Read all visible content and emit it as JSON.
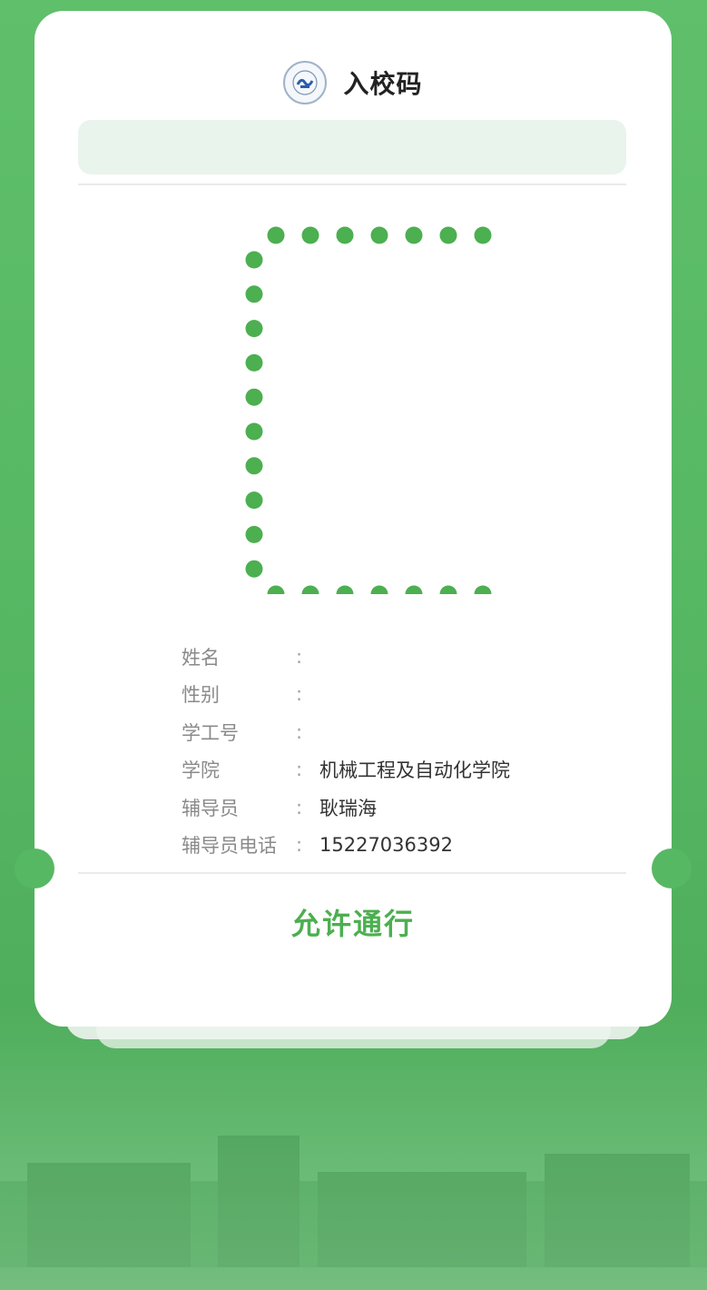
{
  "header": {
    "title": "入校码"
  },
  "info": {
    "rows": [
      {
        "label": "姓名",
        "colon": ":",
        "value": ""
      },
      {
        "label": "性别",
        "colon": ":",
        "value": ""
      },
      {
        "label": "学工号",
        "colon": ":",
        "value": ""
      },
      {
        "label": "学院",
        "colon": ":",
        "value": "机械工程及自动化学院"
      },
      {
        "label": "辅导员",
        "colon": ":",
        "value": "耿瑞海"
      },
      {
        "label": "辅导员电话",
        "colon": ":",
        "value": "15227036392"
      }
    ]
  },
  "status": {
    "text": "允许通行"
  },
  "colors": {
    "accent": "#4caf50",
    "dot": "#4caf50",
    "bar": "#e9f4ec"
  }
}
